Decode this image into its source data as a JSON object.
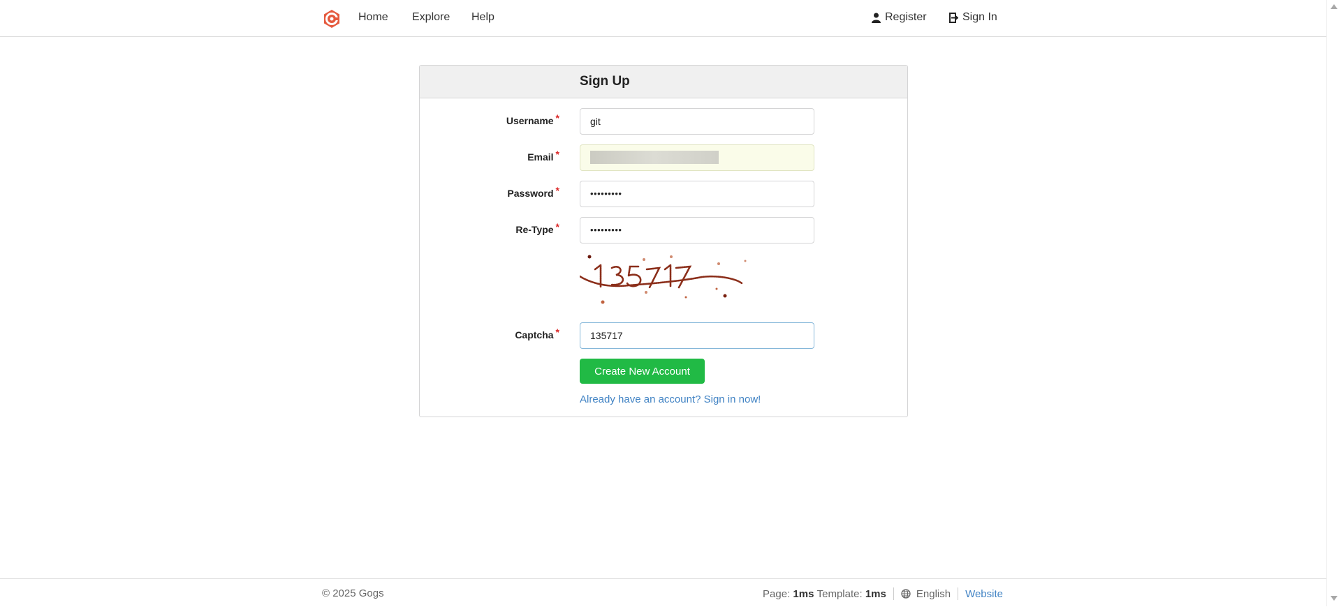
{
  "nav": {
    "home": "Home",
    "explore": "Explore",
    "help": "Help",
    "register": "Register",
    "sign_in": "Sign In"
  },
  "form": {
    "title": "Sign Up",
    "username_label": "Username",
    "username_value": "git",
    "email_label": "Email",
    "password_label": "Password",
    "password_value": "•••••••••",
    "retype_label": "Re-Type",
    "retype_value": "•••••••••",
    "captcha_label": "Captcha",
    "captcha_value": "135717",
    "required_mark": "*",
    "submit_label": "Create New Account",
    "signin_link": "Already have an account? Sign in now!"
  },
  "footer": {
    "copyright": "© 2025 Gogs",
    "page_label": "Page:",
    "page_time": "1ms",
    "template_label": "Template:",
    "template_time": "1ms",
    "language": "English",
    "website": "Website"
  },
  "colors": {
    "brand": "#e5593d",
    "primary_button": "#21ba45",
    "link": "#4183c4",
    "required": "#db2828"
  }
}
